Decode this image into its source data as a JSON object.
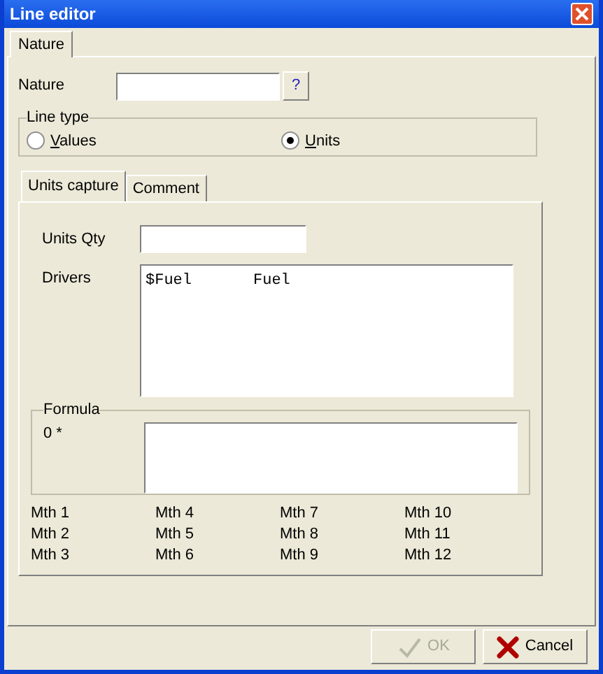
{
  "window": {
    "title": "Line editor"
  },
  "tabs": [
    {
      "label": "Nature",
      "selected": true
    }
  ],
  "nature": {
    "label": "Nature",
    "help_button": "?"
  },
  "line_type": {
    "title": "Line type",
    "options": [
      {
        "label": "Values",
        "selected": false
      },
      {
        "label": "Units",
        "selected": true
      }
    ]
  },
  "inner_tabs": [
    {
      "label": "Units capture",
      "selected": true
    },
    {
      "label": "Comment",
      "selected": false
    }
  ],
  "units_qty": {
    "label": "Units Qty"
  },
  "drivers": {
    "label": "Drivers",
    "rows": [
      {
        "code": "$Fuel",
        "name": "Fuel"
      }
    ]
  },
  "formula": {
    "title": "Formula",
    "prefix": "0 *"
  },
  "months": [
    "Mth 1",
    "Mth 2",
    "Mth 3",
    "Mth 4",
    "Mth 5",
    "Mth 6",
    "Mth 7",
    "Mth 8",
    "Mth 9",
    "Mth 10",
    "Mth 11",
    "Mth 12"
  ],
  "buttons": [
    {
      "label": "OK",
      "kind": "ok",
      "disabled": true
    },
    {
      "label": "Cancel",
      "kind": "cancel",
      "disabled": false
    }
  ]
}
